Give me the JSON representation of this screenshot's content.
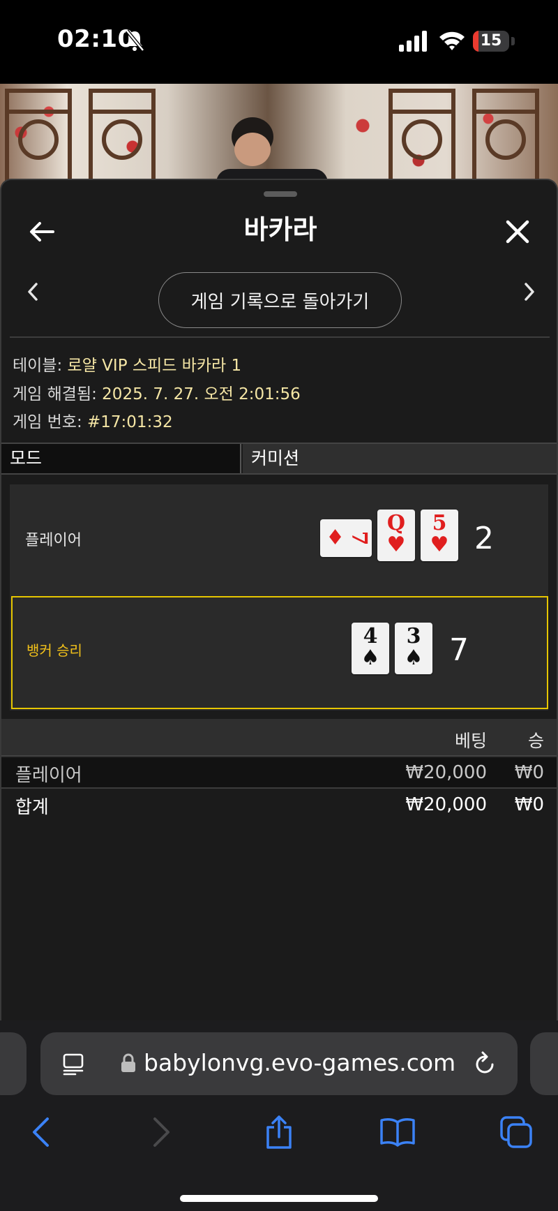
{
  "status_bar": {
    "time": "02:10",
    "battery_level": "15",
    "battery_percent": 15
  },
  "sheet": {
    "title": "바카라",
    "back_history_label": "게임 기록으로 돌아가기"
  },
  "info": {
    "table_label": "테이블: ",
    "table_value": "로얄 VIP 스피드 바카라 1",
    "resolved_label": "게임 해결됨: ",
    "resolved_value": "2025. 7. 27. 오전 2:01:56",
    "game_no_label": "게임 번호: ",
    "game_no_value": "#17:01:32"
  },
  "mode": {
    "label": "모드",
    "value": "커미션"
  },
  "result": {
    "player": {
      "label": "플레이어",
      "score": "2",
      "cards": [
        {
          "rank": "7",
          "suit": "♦",
          "color": "#e01e1e",
          "rotated": true
        },
        {
          "rank": "Q",
          "suit": "♥",
          "color": "#e01e1e",
          "rotated": false
        },
        {
          "rank": "5",
          "suit": "♥",
          "color": "#e01e1e",
          "rotated": false
        }
      ]
    },
    "banker": {
      "label": "뱅커 승리",
      "score": "7",
      "cards": [
        {
          "rank": "4",
          "suit": "♠",
          "color": "#111111",
          "rotated": false
        },
        {
          "rank": "3",
          "suit": "♠",
          "color": "#111111",
          "rotated": false
        }
      ]
    }
  },
  "bets": {
    "header_bet": "베팅",
    "header_win": "승",
    "rows": [
      {
        "name": "플레이어",
        "amount": "₩20,000",
        "win": "₩0"
      },
      {
        "name": "합계",
        "amount": "₩20,000",
        "win": "₩0"
      }
    ]
  },
  "browser": {
    "url": "babylonvg.evo-games.com"
  },
  "colors": {
    "highlight": "#e6c600",
    "link_blue": "#3b82f6",
    "info_value": "#f5e6a5"
  }
}
